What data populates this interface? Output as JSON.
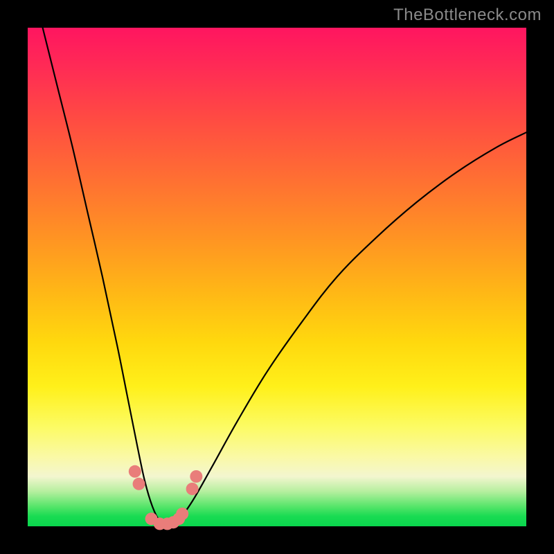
{
  "watermark": "TheBottleneck.com",
  "chart_data": {
    "type": "line",
    "title": "",
    "xlabel": "",
    "ylabel": "",
    "xlim": [
      0,
      100
    ],
    "ylim": [
      0,
      100
    ],
    "grid": false,
    "legend": false,
    "annotations": [],
    "series": [
      {
        "name": "bottleneck-curve",
        "color": "#000000",
        "x": [
          3,
          6,
          9,
          12,
          15,
          18,
          20,
          22,
          23.5,
          25,
          26.5,
          28,
          30,
          33,
          37,
          42,
          48,
          55,
          62,
          70,
          78,
          86,
          94,
          100
        ],
        "y": [
          100,
          88,
          76,
          63,
          50,
          36,
          26,
          16,
          9,
          4,
          1,
          0,
          1,
          5,
          12,
          21,
          31,
          41,
          50,
          58,
          65,
          71,
          76,
          79
        ]
      }
    ],
    "markers": [
      {
        "name": "bottleneck-points",
        "color": "#e97d7a",
        "radius_px": 9,
        "x": [
          21.5,
          22.3,
          24.8,
          26.5,
          28.0,
          29.2,
          30.3,
          31.0,
          33.0,
          33.8
        ],
        "y": [
          11.0,
          8.5,
          1.5,
          0.5,
          0.5,
          0.8,
          1.5,
          2.5,
          7.5,
          10.0
        ]
      }
    ]
  }
}
